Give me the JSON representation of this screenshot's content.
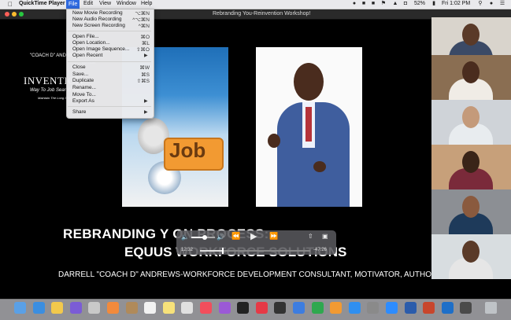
{
  "menubar": {
    "app_name": "QuickTime Player",
    "menus": [
      "File",
      "Edit",
      "View",
      "Window",
      "Help"
    ],
    "battery": "52%",
    "clock": "Fri 1:02 PM"
  },
  "window": {
    "title": "Rebranding You-Reinvention Workshop!"
  },
  "file_menu": {
    "items": [
      {
        "label": "New Movie Recording",
        "shortcut": "⌥⌘N"
      },
      {
        "label": "New Audio Recording",
        "shortcut": "^⌥⌘N"
      },
      {
        "label": "New Screen Recording",
        "shortcut": "^⌘N"
      },
      {
        "label": "Open File...",
        "shortcut": "⌘O"
      },
      {
        "label": "Open Location...",
        "shortcut": "⌘L"
      },
      {
        "label": "Open Image Sequence...",
        "shortcut": "⇧⌘O"
      },
      {
        "label": "Open Recent",
        "shortcut": ""
      },
      {
        "label": "Close",
        "shortcut": "⌘W"
      },
      {
        "label": "Save...",
        "shortcut": "⌘S"
      },
      {
        "label": "Duplicate",
        "shortcut": "⇧⌘S"
      },
      {
        "label": "Rename...",
        "shortcut": ""
      },
      {
        "label": "Move To...",
        "shortcut": ""
      },
      {
        "label": "Export As",
        "shortcut": ""
      },
      {
        "label": "Share",
        "shortcut": ""
      }
    ]
  },
  "slide": {
    "book_author": "\"COACH D\" ANDREWS, CSP",
    "book_author_small": "AUTHOR",
    "book_title": "INVENTION",
    "book_subtitle": "Way To Job Search Success!",
    "book_subtitle2": "Maintain The Long-Term Employment",
    "book_tag": "Job",
    "line1": "REBRANDING Y                         ON PROCESS:",
    "line2": "EQUUS WORKFORCE SOLUTIONS",
    "line3": "DARRELL \"COACH D\" ANDREWS-WORKFORCE DEVELOPMENT CONSULTANT, MOTIVATOR, AUTHO"
  },
  "player": {
    "elapsed": "12:32",
    "remaining": "-47:26",
    "progress": 0.2,
    "volume": 0.55
  },
  "colors": {
    "menu_highlight": "#2f6ae0",
    "slide_bg": "#000000",
    "book_blue": "#1f6fb8",
    "job_orange": "#f29a32"
  },
  "dock_icons": [
    "finder-icon",
    "safari-icon",
    "chrome-icon",
    "siri-icon",
    "launchpad-icon",
    "photos-icon",
    "contacts-icon",
    "calendar-icon",
    "notes-icon",
    "reminders-icon",
    "music-icon",
    "podcasts-icon",
    "tv-icon",
    "news-icon",
    "stocks-icon",
    "keynote-icon",
    "numbers-icon",
    "pages-icon",
    "app-store-icon",
    "system-preferences-icon",
    "zoom-icon",
    "word-icon",
    "powerpoint-icon",
    "outlook-icon",
    "quicktime-icon",
    "trash-icon"
  ]
}
